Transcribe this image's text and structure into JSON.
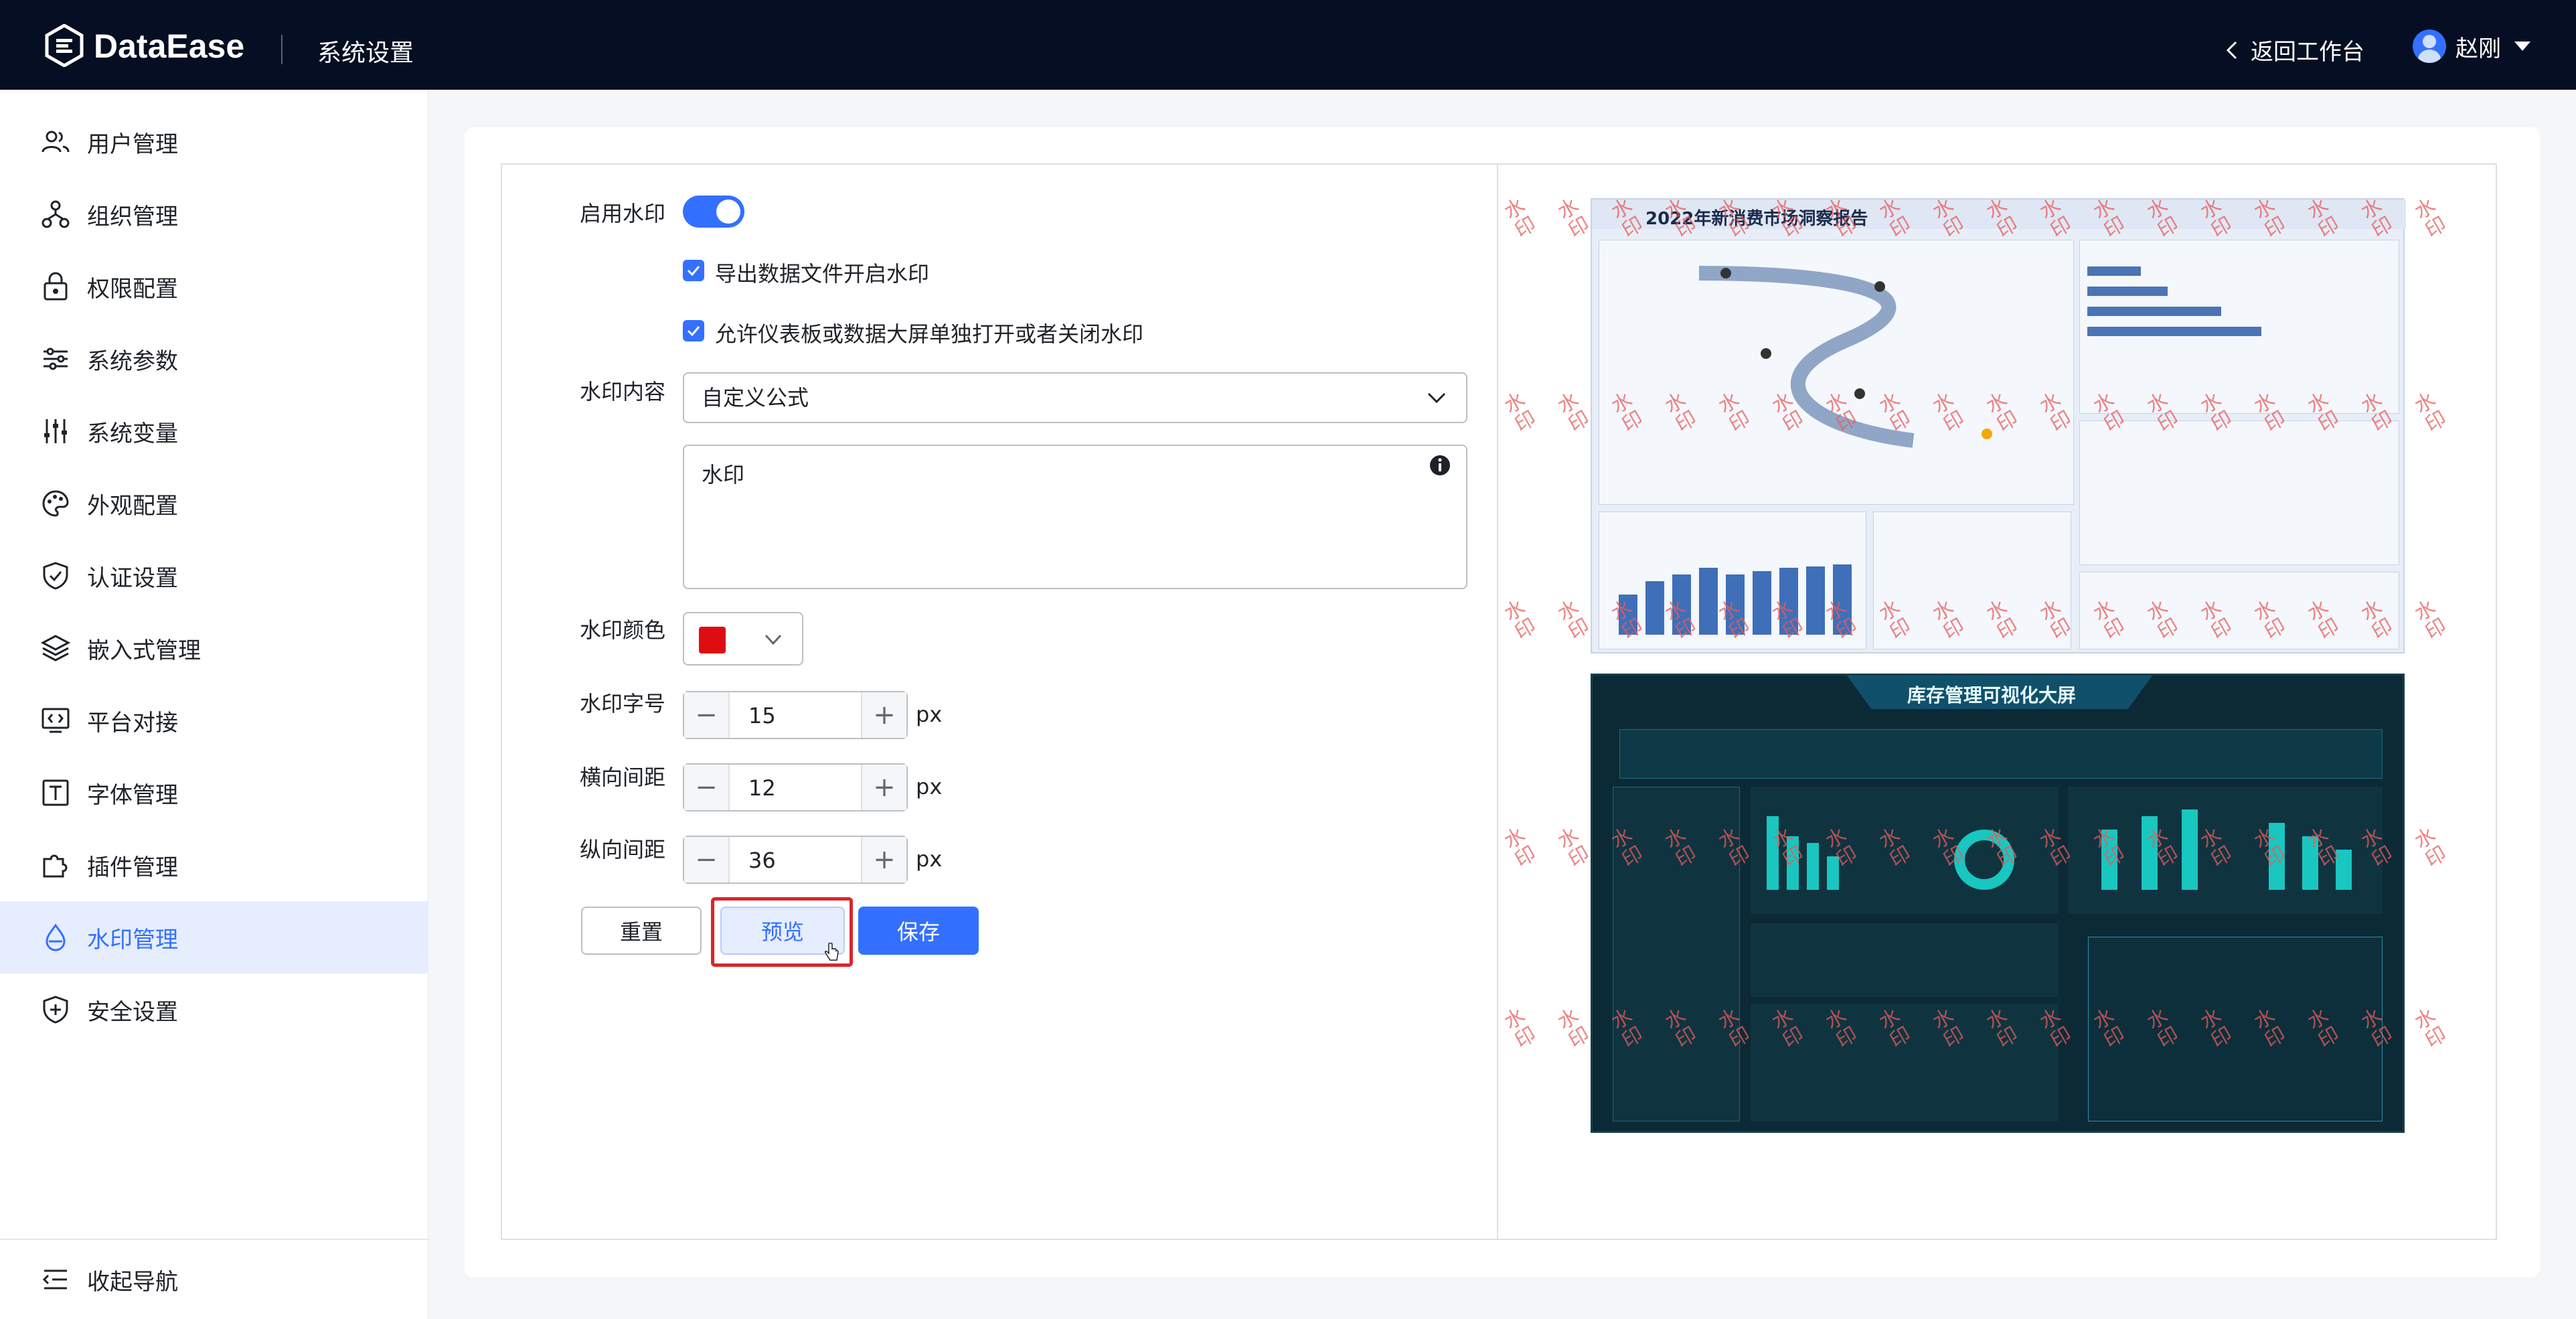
{
  "header": {
    "brand": "DataEase",
    "section_title": "系统设置",
    "back_link": "返回工作台",
    "user_name": "赵刚"
  },
  "sidebar": {
    "items": [
      {
        "label": "用户管理",
        "icon": "users-icon"
      },
      {
        "label": "组织管理",
        "icon": "org-tree-icon"
      },
      {
        "label": "权限配置",
        "icon": "lock-icon"
      },
      {
        "label": "系统参数",
        "icon": "sliders-icon"
      },
      {
        "label": "系统变量",
        "icon": "variables-icon"
      },
      {
        "label": "外观配置",
        "icon": "palette-icon"
      },
      {
        "label": "认证设置",
        "icon": "shield-check-icon"
      },
      {
        "label": "嵌入式管理",
        "icon": "layers-icon"
      },
      {
        "label": "平台对接",
        "icon": "code-monitor-icon"
      },
      {
        "label": "字体管理",
        "icon": "font-icon"
      },
      {
        "label": "插件管理",
        "icon": "puzzle-icon"
      },
      {
        "label": "水印管理",
        "icon": "drop-icon",
        "active": true
      },
      {
        "label": "安全设置",
        "icon": "shield-plus-icon"
      }
    ],
    "collapse_label": "收起导航"
  },
  "form": {
    "enable_label": "启用水印",
    "enabled": true,
    "export_checkbox_label": "导出数据文件开启水印",
    "export_checked": true,
    "allow_checkbox_label": "允许仪表板或数据大屏单独打开或者关闭水印",
    "allow_checked": true,
    "content_label": "水印内容",
    "content_select_value": "自定义公式",
    "content_text": "水印",
    "color_label": "水印颜色",
    "color_value": "#dd0d12",
    "font_size_label": "水印字号",
    "font_size_value": "15",
    "h_spacing_label": "横向间距",
    "h_spacing_value": "12",
    "v_spacing_label": "纵向间距",
    "v_spacing_value": "36",
    "unit": "px",
    "reset_label": "重置",
    "preview_label": "预览",
    "save_label": "保存"
  },
  "preview": {
    "watermark_text": "水印",
    "dashboard1_title": "2022年新消费市场洞察报告",
    "dashboard2_title": "库存管理可视化大屏"
  },
  "colors": {
    "accent": "#3370ff",
    "header_bg": "#050e22",
    "highlight": "#d9262c",
    "watermark": "#e85b5b"
  }
}
